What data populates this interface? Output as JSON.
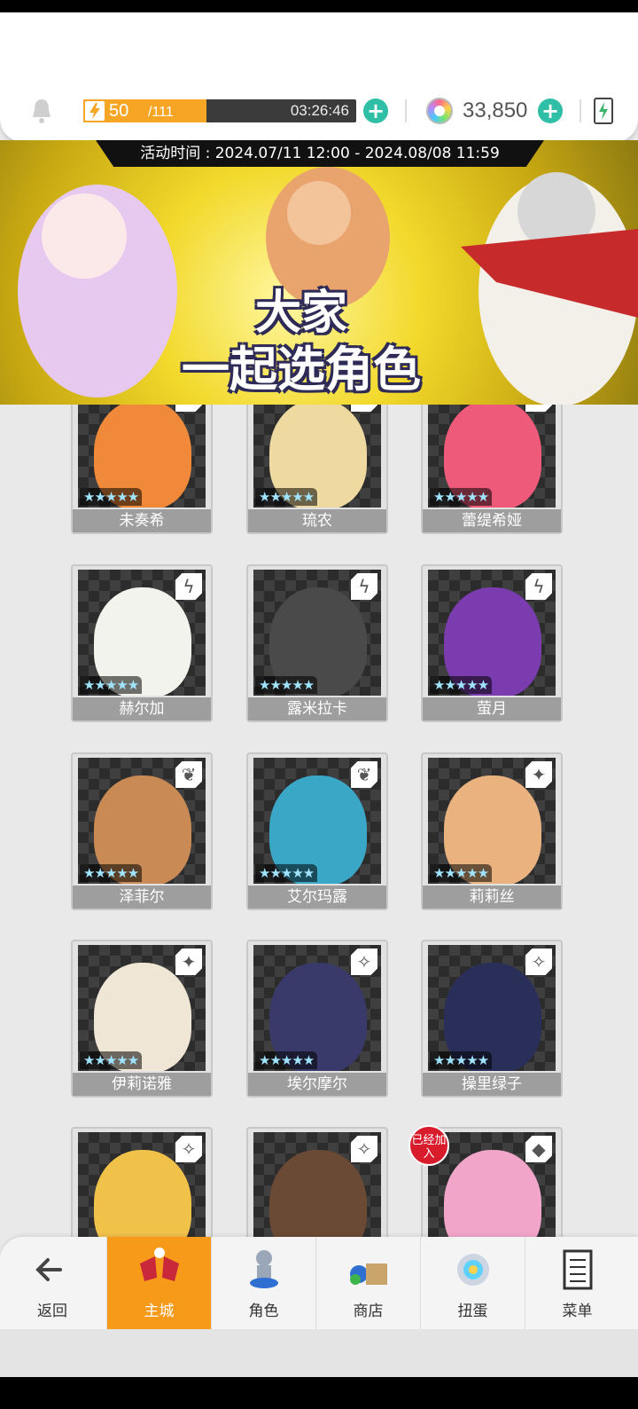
{
  "header": {
    "stamina_current": "50",
    "stamina_max": "/111",
    "stamina_fraction": 0.45,
    "stamina_timer": "03:26:46",
    "gems": "33,850",
    "icons": [
      "bell-icon",
      "lightning-icon",
      "plus-icon",
      "gem-icon",
      "battery-icon"
    ]
  },
  "banner": {
    "period": "活动时间 : 2024.07/11 12:00 - 2024.08/08 11:59",
    "title_line1": "大家",
    "title_line2": "一起选角色"
  },
  "characters": [
    {
      "name": "未奏希",
      "stars": "★★★★★",
      "element": "heart",
      "color": "#f08a3a"
    },
    {
      "name": "琉农",
      "stars": "★★★★★",
      "element": "heart",
      "color": "#eed9a0"
    },
    {
      "name": "蕾缇希娅",
      "stars": "★★★★★",
      "element": "heart",
      "color": "#ee5a7a"
    },
    {
      "name": "赫尔加",
      "stars": "★★★★★",
      "element": "lightning",
      "color": "#f3f3ee"
    },
    {
      "name": "露米拉卡",
      "stars": "★★★★★",
      "element": "lightning",
      "color": "#4a4a4a"
    },
    {
      "name": "萤月",
      "stars": "★★★★★",
      "element": "lightning",
      "color": "#7a3cae"
    },
    {
      "name": "泽菲尔",
      "stars": "★★★★★",
      "element": "leaf",
      "color": "#c98a55"
    },
    {
      "name": "艾尔玛露",
      "stars": "★★★★★",
      "element": "leaf",
      "color": "#3aa7c7"
    },
    {
      "name": "莉莉丝",
      "stars": "★★★★★",
      "element": "light",
      "color": "#e9b27f"
    },
    {
      "name": "伊莉诺雅",
      "stars": "★★★★★",
      "element": "light",
      "color": "#f0e6d6"
    },
    {
      "name": "埃尔摩尔",
      "stars": "★★★★★",
      "element": "dark",
      "color": "#3a3a6a"
    },
    {
      "name": "操里绿子",
      "stars": "★★★★★",
      "element": "dark",
      "color": "#2a2f5a"
    },
    {
      "name": "",
      "stars": "",
      "element": "dark",
      "color": "#f1c24a"
    },
    {
      "name": "",
      "stars": "",
      "element": "dark",
      "color": "#6b4a35"
    },
    {
      "name": "",
      "stars": "",
      "element": "fire",
      "color": "#f1a5c8",
      "badge": "已经加入"
    }
  ],
  "nav": [
    {
      "label": "返回",
      "icon": "back-arrow-icon"
    },
    {
      "label": "主城",
      "icon": "castle-icon",
      "active": true
    },
    {
      "label": "角色",
      "icon": "character-icon"
    },
    {
      "label": "商店",
      "icon": "shop-icon"
    },
    {
      "label": "扭蛋",
      "icon": "gacha-icon"
    },
    {
      "label": "菜单",
      "icon": "menu-icon"
    }
  ]
}
